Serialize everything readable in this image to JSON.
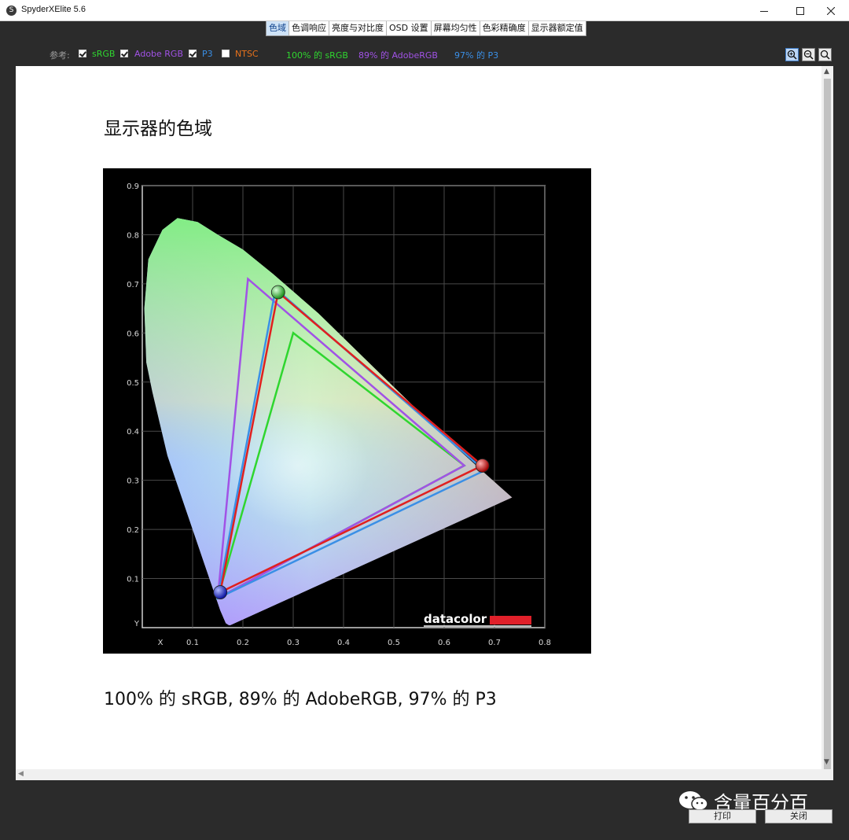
{
  "window": {
    "app_icon_glyph": "S",
    "title": "SpyderXElite 5.6",
    "controls": [
      "minimize-icon",
      "maximize-icon",
      "close-icon"
    ]
  },
  "tabs": [
    {
      "label": "色域",
      "active": true
    },
    {
      "label": "色调响应",
      "active": false
    },
    {
      "label": "亮度与对比度",
      "active": false
    },
    {
      "label": "OSD 设置",
      "active": false
    },
    {
      "label": "屏幕均匀性",
      "active": false
    },
    {
      "label": "色彩精确度",
      "active": false
    },
    {
      "label": "显示器额定值",
      "active": false
    }
  ],
  "reference": {
    "label": "参考:",
    "items": [
      {
        "name": "sRGB",
        "checked": true,
        "color": "#2fd62f"
      },
      {
        "name": "Adobe RGB",
        "checked": true,
        "color": "#a152e6"
      },
      {
        "name": "P3",
        "checked": true,
        "color": "#3a8fe6"
      },
      {
        "name": "NTSC",
        "checked": false,
        "color": "#e8721c"
      }
    ],
    "coverage": [
      {
        "text": "100% 的 sRGB",
        "color": "#2fd62f"
      },
      {
        "text": "89% 的 AdobeRGB",
        "color": "#a152e6"
      },
      {
        "text": "97% 的 P3",
        "color": "#3a8fe6"
      }
    ]
  },
  "zoom": {
    "buttons": [
      "zoom-in-icon",
      "zoom-out-icon",
      "zoom-fit-icon"
    ],
    "active": 0
  },
  "report": {
    "title": "显示器的色域",
    "summary": "100% 的 sRGB, 89% 的 AdobeRGB, 97% 的 P3"
  },
  "chart_data": {
    "type": "scatter",
    "title": "",
    "xlabel": "X",
    "ylabel": "Y",
    "xlim": [
      0.0,
      0.8
    ],
    "ylim": [
      0.0,
      0.9
    ],
    "x_ticks": [
      "0.1",
      "0.2",
      "0.3",
      "0.4",
      "0.5",
      "0.6",
      "0.7",
      "0.8"
    ],
    "y_ticks": [
      "0.1",
      "0.2",
      "0.3",
      "0.4",
      "0.5",
      "0.6",
      "0.7",
      "0.8",
      "0.9"
    ],
    "grid": true,
    "brand_label": "datacolor",
    "spectral_locus": [
      [
        0.175,
        0.005
      ],
      [
        0.172,
        0.005
      ],
      [
        0.166,
        0.009
      ],
      [
        0.155,
        0.035
      ],
      [
        0.14,
        0.08
      ],
      [
        0.12,
        0.14
      ],
      [
        0.09,
        0.23
      ],
      [
        0.05,
        0.35
      ],
      [
        0.02,
        0.48
      ],
      [
        0.008,
        0.54
      ],
      [
        0.004,
        0.65
      ],
      [
        0.012,
        0.75
      ],
      [
        0.04,
        0.81
      ],
      [
        0.07,
        0.834
      ],
      [
        0.11,
        0.826
      ],
      [
        0.15,
        0.8
      ],
      [
        0.2,
        0.77
      ],
      [
        0.26,
        0.72
      ],
      [
        0.35,
        0.64
      ],
      [
        0.44,
        0.55
      ],
      [
        0.53,
        0.46
      ],
      [
        0.61,
        0.38
      ],
      [
        0.68,
        0.315
      ],
      [
        0.735,
        0.265
      ]
    ],
    "series": [
      {
        "name": "sRGB",
        "color": "#2fd62f",
        "points": [
          [
            0.64,
            0.33
          ],
          [
            0.3,
            0.6
          ],
          [
            0.15,
            0.06
          ]
        ]
      },
      {
        "name": "Adobe RGB",
        "color": "#a152e6",
        "points": [
          [
            0.64,
            0.33
          ],
          [
            0.21,
            0.71
          ],
          [
            0.15,
            0.06
          ]
        ]
      },
      {
        "name": "P3",
        "color": "#3a8fe6",
        "points": [
          [
            0.68,
            0.32
          ],
          [
            0.265,
            0.69
          ],
          [
            0.15,
            0.06
          ]
        ]
      },
      {
        "name": "Display",
        "color": "#e02020",
        "points": [
          [
            0.676,
            0.33
          ],
          [
            0.27,
            0.683
          ],
          [
            0.155,
            0.072
          ]
        ]
      }
    ],
    "primaries": [
      {
        "name": "red",
        "x": 0.676,
        "y": 0.33,
        "color": "#e02020"
      },
      {
        "name": "green",
        "x": 0.27,
        "y": 0.683,
        "color": "#2fd62f"
      },
      {
        "name": "blue",
        "x": 0.155,
        "y": 0.072,
        "color": "#2030e0"
      }
    ]
  },
  "footer": {
    "print_label": "打印",
    "close_label": "关闭",
    "watermark": "含量百分百"
  }
}
